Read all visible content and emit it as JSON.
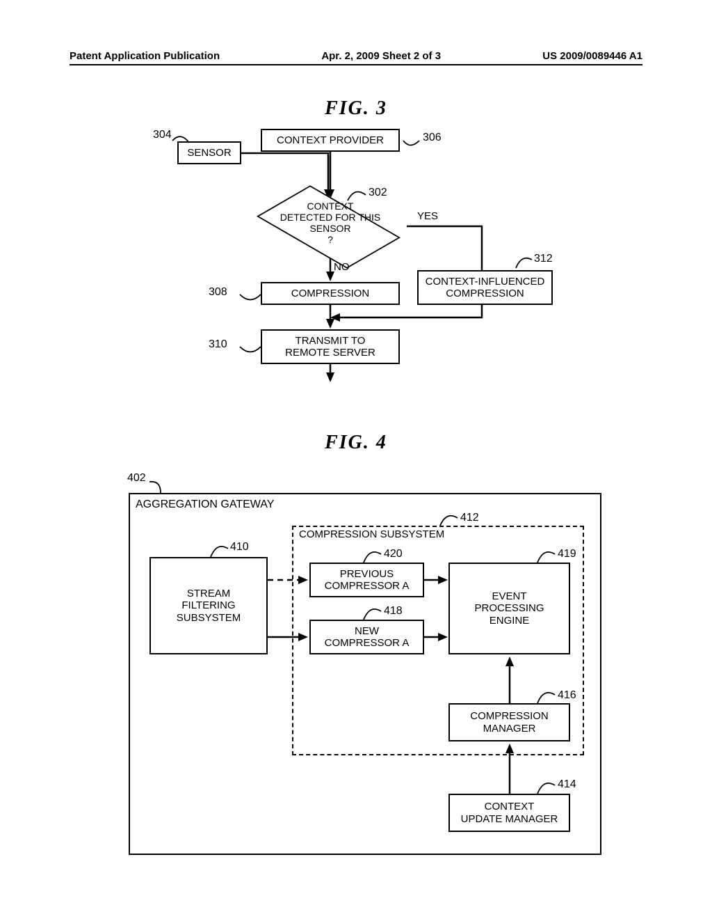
{
  "header": {
    "left": "Patent Application Publication",
    "center": "Apr. 2, 2009  Sheet 2 of 3",
    "right": "US 2009/0089446 A1"
  },
  "fig3": {
    "title": "FIG.  3",
    "sensor": "SENSOR",
    "context_provider": "CONTEXT PROVIDER",
    "decision": "CONTEXT\nDETECTED FOR THIS\nSENSOR\n?",
    "yes": "YES",
    "no": "NO",
    "compression": "COMPRESSION",
    "cic": "CONTEXT-INFLUENCED\nCOMPRESSION",
    "transmit": "TRANSMIT TO\nREMOTE SERVER",
    "ref302": "302",
    "ref304": "304",
    "ref306": "306",
    "ref308": "308",
    "ref310": "310",
    "ref312": "312"
  },
  "fig4": {
    "title": "FIG.  4",
    "ag": "AGGREGATION GATEWAY",
    "sfs": "STREAM\nFILTERING\nSUBSYSTEM",
    "cs": "COMPRESSION SUBSYSTEM",
    "prev": "PREVIOUS\nCOMPRESSOR A",
    "newc": "NEW\nCOMPRESSOR A",
    "epe": "EVENT\nPROCESSING\nENGINE",
    "cm": "COMPRESSION\nMANAGER",
    "cum": "CONTEXT\nUPDATE MANAGER",
    "ref402": "402",
    "ref410": "410",
    "ref412": "412",
    "ref414": "414",
    "ref416": "416",
    "ref418": "418",
    "ref419": "419",
    "ref420": "420"
  }
}
